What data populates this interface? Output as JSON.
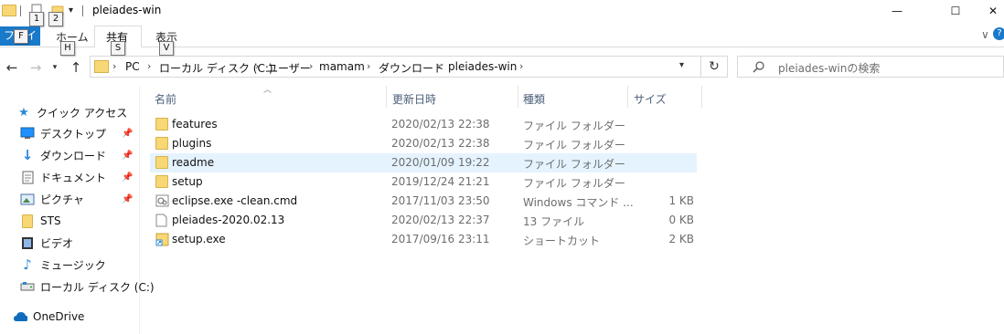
{
  "window": {
    "title": "pleiades-win",
    "minimize_glyph": "—",
    "maximize_glyph": "☐",
    "close_glyph": "✕"
  },
  "keytips": {
    "qat1": "1",
    "qat2": "2",
    "file": "F",
    "home": "H",
    "share": "S",
    "view": "V"
  },
  "ribbon": {
    "file_tab": "ファイル",
    "tabs": [
      "ホーム",
      "共有",
      "表示"
    ],
    "active_tab": "共有",
    "chevron_glyph": "∨",
    "help_glyph": "?"
  },
  "address": {
    "breadcrumbs": [
      "PC",
      "ローカル ディスク (C:)",
      "ユーザー",
      "mamam",
      "ダウンロード",
      "pleiades-win"
    ],
    "separator": "›"
  },
  "search": {
    "placeholder": "pleiades-winの検索"
  },
  "nav_pane": {
    "items": [
      {
        "label": "クイック アクセス",
        "icon": "star-icon",
        "pinned": false
      },
      {
        "label": "デスクトップ",
        "icon": "desktop-icon",
        "pinned": true
      },
      {
        "label": "ダウンロード",
        "icon": "download-icon",
        "pinned": true
      },
      {
        "label": "ドキュメント",
        "icon": "document-icon",
        "pinned": true
      },
      {
        "label": "ピクチャ",
        "icon": "picture-icon",
        "pinned": true
      },
      {
        "label": "STS",
        "icon": "folder-icon",
        "pinned": false
      },
      {
        "label": "ビデオ",
        "icon": "video-icon",
        "pinned": false
      },
      {
        "label": "ミュージック",
        "icon": "music-icon",
        "pinned": false
      },
      {
        "label": "ローカル ディスク (C:)",
        "icon": "drive-icon",
        "pinned": false
      },
      {
        "label": "OneDrive",
        "icon": "onedrive-icon",
        "pinned": false
      }
    ]
  },
  "columns": {
    "name": "名前",
    "date": "更新日時",
    "type": "種類",
    "size": "サイズ"
  },
  "files": [
    {
      "name": "features",
      "date": "2020/02/13 22:38",
      "type": "ファイル フォルダー",
      "size": "",
      "icon": "folder-icon"
    },
    {
      "name": "plugins",
      "date": "2020/02/13 22:38",
      "type": "ファイル フォルダー",
      "size": "",
      "icon": "folder-icon"
    },
    {
      "name": "readme",
      "date": "2020/01/09 19:22",
      "type": "ファイル フォルダー",
      "size": "",
      "icon": "folder-icon",
      "selected": true
    },
    {
      "name": "setup",
      "date": "2019/12/24 21:21",
      "type": "ファイル フォルダー",
      "size": "",
      "icon": "folder-icon"
    },
    {
      "name": "eclipse.exe -clean.cmd",
      "date": "2017/11/03 23:50",
      "type": "Windows コマンド ...",
      "size": "1 KB",
      "icon": "cmd-file-icon"
    },
    {
      "name": "pleiades-2020.02.13",
      "date": "2020/02/13 22:37",
      "type": "13 ファイル",
      "size": "0 KB",
      "icon": "file-icon"
    },
    {
      "name": "setup.exe",
      "date": "2017/09/16 23:11",
      "type": "ショートカット",
      "size": "2 KB",
      "icon": "shortcut-icon"
    }
  ],
  "colors": {
    "accent": "#1979ca",
    "folder": "#f8d775",
    "selected_row": "#e5f3ff",
    "header_text": "#4c607a"
  }
}
